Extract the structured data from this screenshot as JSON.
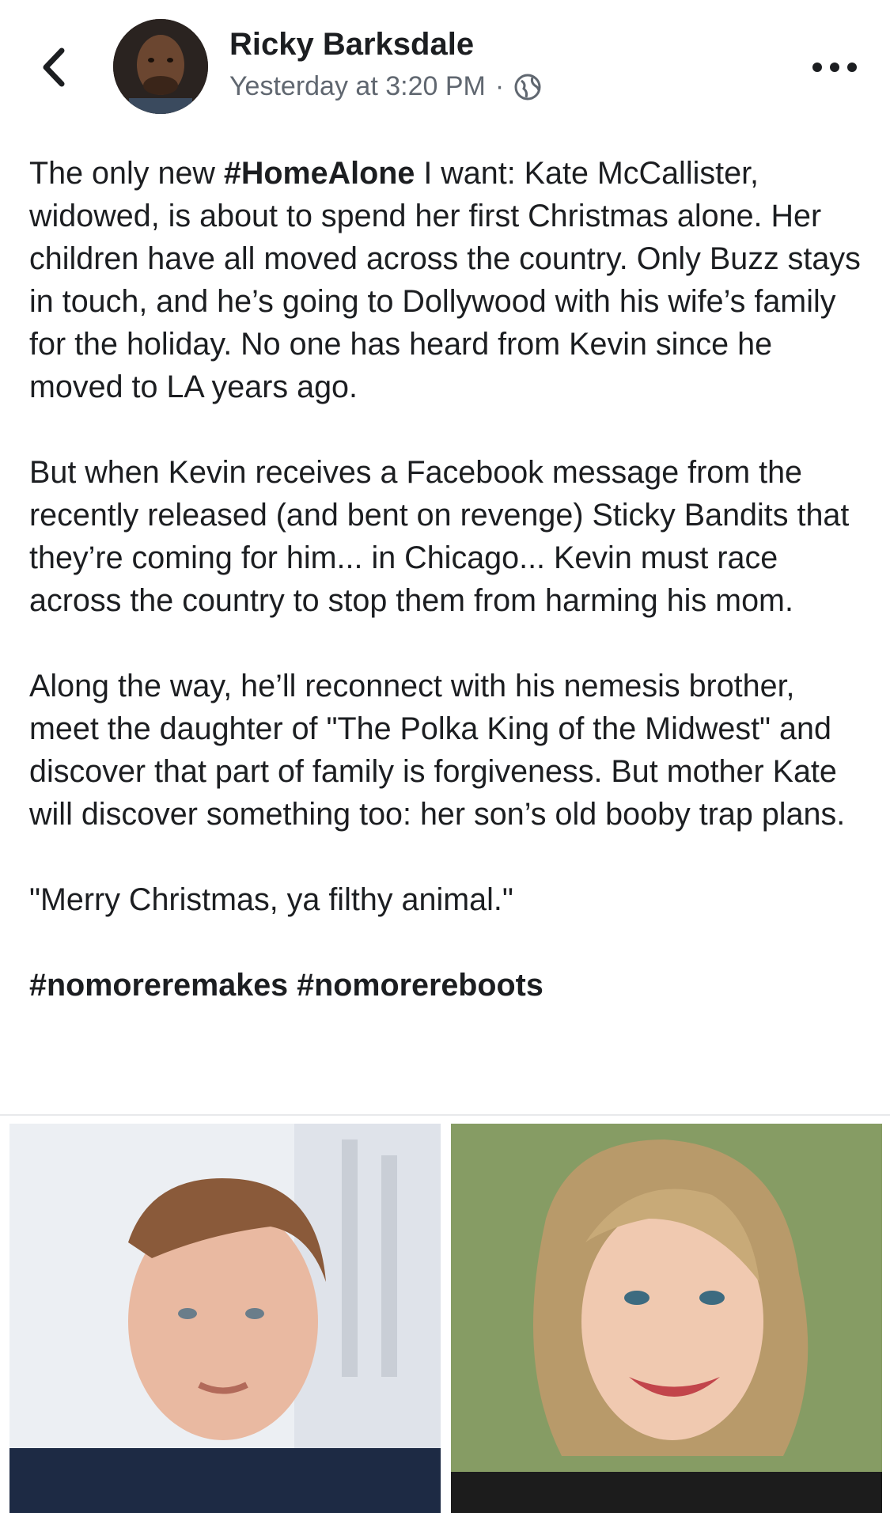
{
  "header": {
    "author_name": "Ricky Barksdale",
    "timestamp": "Yesterday at 3:20 PM",
    "separator": "·",
    "privacy_icon": "globe-icon",
    "back_icon": "chevron-left-icon",
    "more_icon": "more-horizontal-icon"
  },
  "post": {
    "p1_pre": "The only new ",
    "p1_hashtag": "#HomeAlone",
    "p1_post": " I want: Kate McCallister, widowed, is about to spend her first Christmas alone. Her children have all moved across the country. Only Buzz stays in touch, and he’s going to Dollywood with his wife’s family for the holiday. No one has heard from Kevin since he moved to LA years ago.",
    "p2": "But when Kevin receives a Facebook message from the recently released (and bent on revenge) Sticky Bandits that they’re coming for him... in Chicago... Kevin must race across the country to stop them from harming his mom.",
    "p3": "Along the way, he’ll reconnect with his nemesis brother, meet the daughter of \"The Polka King of the Midwest\" and discover that part of family is forgiveness.  But mother Kate will discover something too: her son’s old booby trap plans.",
    "p4": "\"Merry Christmas, ya filthy animal.\"",
    "hashtag1": "#nomoreremakes",
    "hashtag2": "#nomorereboots"
  },
  "colors": {
    "text": "#1c1e21",
    "meta": "#606770",
    "divider": "#e8e9eb"
  }
}
